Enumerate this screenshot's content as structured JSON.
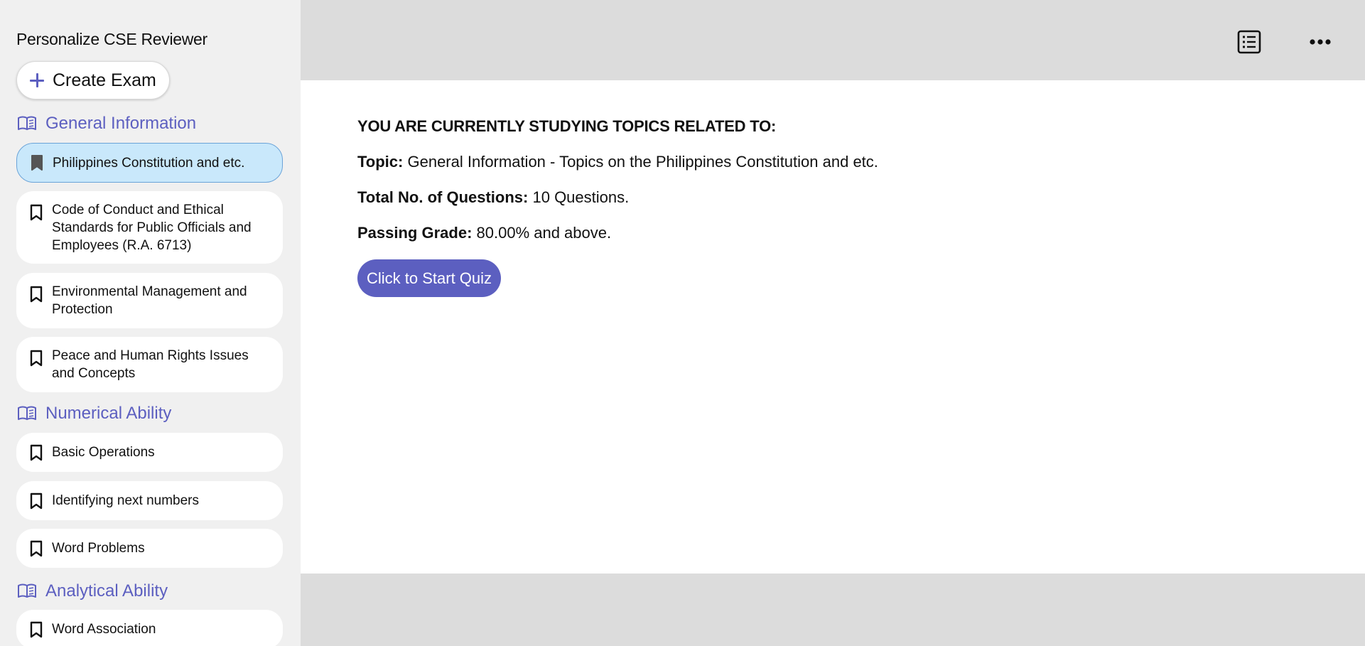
{
  "app": {
    "title": "Personalize CSE Reviewer"
  },
  "sidebar": {
    "create_button": {
      "label": "Create Exam",
      "icon": "plus-icon"
    },
    "sections": [
      {
        "title": "General Information",
        "icon": "book-icon",
        "items": [
          {
            "label": "Philippines Constitution and etc.",
            "active": true
          },
          {
            "label": "Code of Conduct and Ethical Standards for Public Officials and Employees (R.A. 6713)",
            "active": false
          },
          {
            "label": "Environmental Management and Protection",
            "active": false
          },
          {
            "label": "Peace and Human Rights Issues and Concepts",
            "active": false
          }
        ]
      },
      {
        "title": "Numerical Ability",
        "icon": "book-icon",
        "items": [
          {
            "label": "Basic Operations",
            "active": false
          },
          {
            "label": "Identifying next numbers",
            "active": false
          },
          {
            "label": "Word Problems",
            "active": false
          }
        ]
      },
      {
        "title": "Analytical Ability",
        "icon": "book-icon",
        "items": [
          {
            "label": "Word Association",
            "active": false
          }
        ]
      }
    ]
  },
  "toolbar": {
    "icons": [
      "list-icon",
      "more-icon"
    ]
  },
  "main": {
    "heading": "YOU ARE CURRENTLY STUDYING TOPICS RELATED TO:",
    "topic_label": "Topic:",
    "topic_value": "General Information - Topics on the Philippines Constitution and etc.",
    "questions_label": "Total No. of Questions:",
    "questions_value": "10 Questions.",
    "passing_label": "Passing Grade:",
    "passing_value": "80.00% and above.",
    "start_button": "Click to Start Quiz"
  },
  "colors": {
    "accent": "#5c5fc0",
    "active_item_bg": "#c9e8fb",
    "sidebar_bg": "#f0f0f0",
    "band_bg": "#dcdcdc"
  }
}
